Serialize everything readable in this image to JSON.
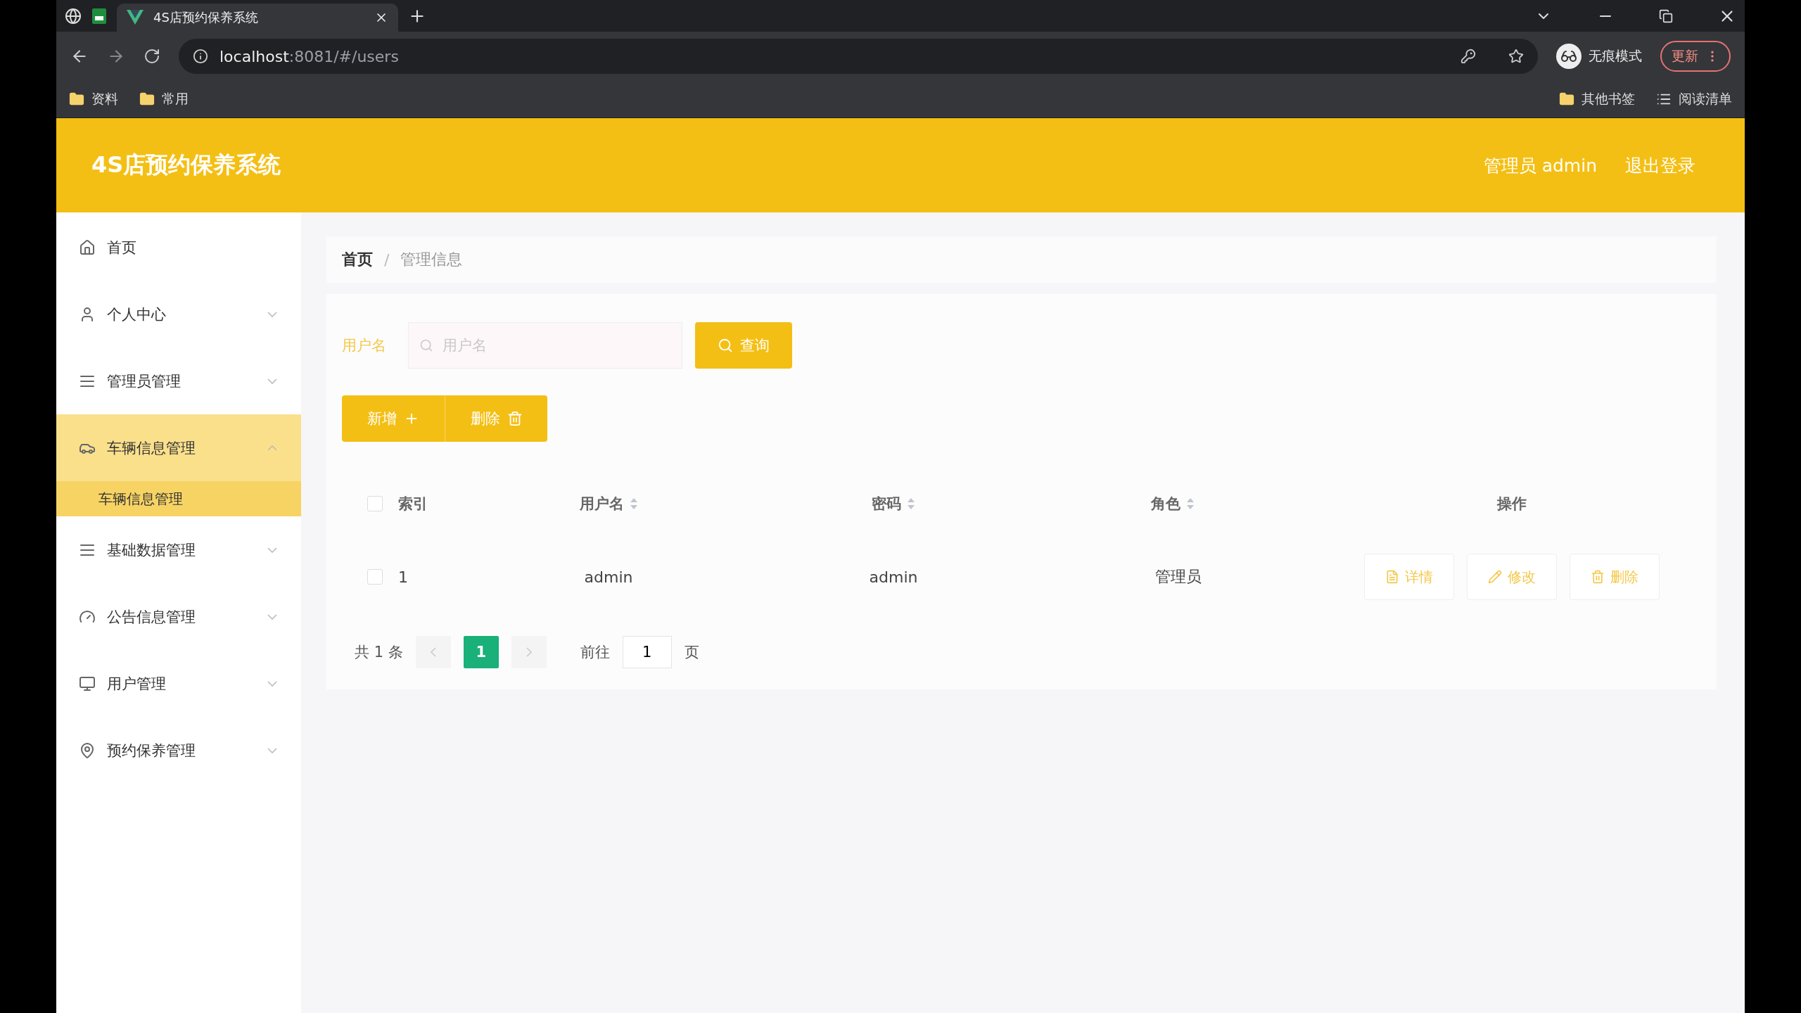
{
  "browser": {
    "tabs": [
      {
        "title": "4S店预约保养系统",
        "selected": true
      }
    ],
    "url_host": "localhost",
    "url_rest": ":8081/#/users",
    "profile": "无痕模式",
    "update": "更新",
    "bookmarks": [
      "资料",
      "常用"
    ],
    "bookmarks_right": [
      "其他书签",
      "阅读清单"
    ]
  },
  "header": {
    "title": "4S店预约保养系统",
    "user": "管理员 admin",
    "logout": "退出登录"
  },
  "sidebar": {
    "items": [
      {
        "label": "首页",
        "expandable": false,
        "selected": false
      },
      {
        "label": "个人中心",
        "expandable": true,
        "expanded": false,
        "selected": false
      },
      {
        "label": "管理员管理",
        "expandable": true,
        "expanded": false,
        "selected": false
      },
      {
        "label": "车辆信息管理",
        "expandable": true,
        "expanded": true,
        "selected": true,
        "children": [
          {
            "label": "车辆信息管理",
            "selected": true
          }
        ]
      },
      {
        "label": "基础数据管理",
        "expandable": true,
        "expanded": false,
        "selected": false
      },
      {
        "label": "公告信息管理",
        "expandable": true,
        "expanded": false,
        "selected": false
      },
      {
        "label": "用户管理",
        "expandable": true,
        "expanded": false,
        "selected": false
      },
      {
        "label": "预约保养管理",
        "expandable": true,
        "expanded": false,
        "selected": false
      }
    ]
  },
  "breadcrumb": {
    "separator": "/",
    "items": [
      "首页",
      "管理信息"
    ]
  },
  "search": {
    "label": "用户名",
    "placeholder": "用户名",
    "button": "查询"
  },
  "actions": [
    {
      "label": "新增",
      "kind": "add"
    },
    {
      "label": "删除",
      "kind": "delete"
    }
  ],
  "table": {
    "all_checked": false,
    "columns": [
      {
        "label": "索引",
        "sortable": false
      },
      {
        "label": "用户名",
        "sortable": true
      },
      {
        "label": "密码",
        "sortable": true
      },
      {
        "label": "角色",
        "sortable": true
      },
      {
        "label": "操作",
        "sortable": false
      }
    ],
    "rows": [
      {
        "checked": false,
        "cells": [
          "1",
          "admin",
          "admin",
          "管理员"
        ],
        "actions": [
          {
            "label": "详情",
            "kind": "detail"
          },
          {
            "label": "修改",
            "kind": "edit"
          },
          {
            "label": "删除",
            "kind": "delete"
          }
        ]
      }
    ]
  },
  "pagination": {
    "total": "共 1 条",
    "pages": [
      {
        "label": "1",
        "selected": true
      }
    ],
    "goto_label": "前往",
    "goto_value": "1",
    "suffix": "页"
  }
}
